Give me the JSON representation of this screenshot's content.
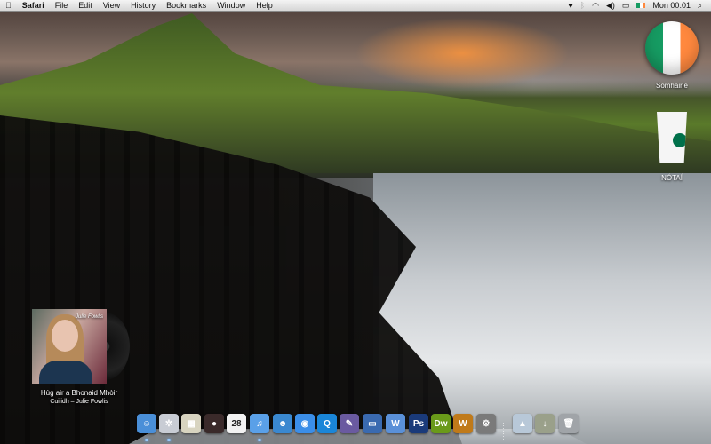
{
  "menubar": {
    "apple": "",
    "app": "Safari",
    "items": [
      "File",
      "Edit",
      "View",
      "History",
      "Bookmarks",
      "Window",
      "Help"
    ],
    "clock": "Mon 00:01",
    "search_icon": "⌕"
  },
  "desktop_icons": [
    {
      "label": "Somhairle",
      "icon": "ireland-flag"
    },
    {
      "label": "NÓTAÍ",
      "icon": "coffee-cup"
    }
  ],
  "now_playing": {
    "track": "Hùg air a Bhonaid Mhòir",
    "album_artist": "Cuilidh – Julie Fowlis",
    "cover_text": "Julie Fowlis"
  },
  "dock": {
    "items": [
      {
        "name": "finder",
        "glyph": "☺",
        "color": "#4a8fd8",
        "running": true
      },
      {
        "name": "safari",
        "glyph": "✲",
        "color": "#c8ccd4",
        "running": true
      },
      {
        "name": "preview",
        "glyph": "▦",
        "color": "#d8d4c0",
        "running": false
      },
      {
        "name": "dvd-player",
        "glyph": "●",
        "color": "#3a2a2a",
        "running": false
      },
      {
        "name": "ical",
        "glyph": "28",
        "color": "#f2f2f2",
        "running": false
      },
      {
        "name": "itunes",
        "glyph": "♫",
        "color": "#5aa0e8",
        "running": true
      },
      {
        "name": "messenger",
        "glyph": "☻",
        "color": "#3a88d0",
        "running": false
      },
      {
        "name": "ichat",
        "glyph": "◉",
        "color": "#3b8ee8",
        "running": false
      },
      {
        "name": "quicktime",
        "glyph": "Q",
        "color": "#1a86d8",
        "running": false
      },
      {
        "name": "script-editor",
        "glyph": "✎",
        "color": "#6a5aa0",
        "running": false
      },
      {
        "name": "keynote",
        "glyph": "▭",
        "color": "#3a6ab0",
        "running": false
      },
      {
        "name": "word",
        "glyph": "W",
        "color": "#5a90d8",
        "running": false
      },
      {
        "name": "photoshop",
        "glyph": "Ps",
        "color": "#1a3a7a",
        "running": false
      },
      {
        "name": "dreamweaver",
        "glyph": "Dw",
        "color": "#6a9a1a",
        "running": false
      },
      {
        "name": "world-of-warcraft",
        "glyph": "W",
        "color": "#c07a1a",
        "running": false
      },
      {
        "name": "system-preferences",
        "glyph": "⚙",
        "color": "#7a7a7a",
        "running": false
      },
      {
        "name": "applications-stack",
        "glyph": "▲",
        "color": "#b8c8d8",
        "running": false
      },
      {
        "name": "downloads-stack",
        "glyph": "↓",
        "color": "#9aa08a",
        "running": false
      },
      {
        "name": "trash",
        "glyph": "🗑",
        "color": "#a0a4a8",
        "running": false
      }
    ]
  }
}
